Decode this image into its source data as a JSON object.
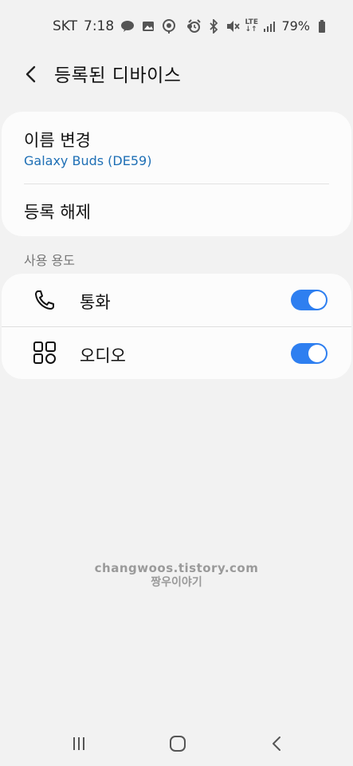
{
  "status_bar": {
    "carrier": "SKT",
    "time": "7:18",
    "battery": "79%",
    "left_icons": [
      "talk-icon",
      "gallery-icon",
      "location-icon",
      "dot-icon"
    ],
    "right_icons": [
      "alarm-icon",
      "bluetooth-icon",
      "mute-icon",
      "lte-icon",
      "signal-icon",
      "battery-icon"
    ],
    "lte_label": "LTE"
  },
  "header": {
    "title": "등록된 디바이스",
    "back_icon": "back-arrow-icon"
  },
  "device_card": {
    "rename_title": "이름 변경",
    "device_name": "Galaxy Buds (DE59)",
    "unregister_label": "등록 해제"
  },
  "usage": {
    "section_label": "사용 용도",
    "items": [
      {
        "label": "통화",
        "icon": "phone-icon",
        "enabled": true
      },
      {
        "label": "오디오",
        "icon": "audio-icon",
        "enabled": true
      }
    ]
  },
  "watermark": {
    "line1": "changwoos.tistory.com",
    "line2": "짱우이야기"
  },
  "navbar": {
    "recents": "recents-icon",
    "home": "home-icon",
    "back": "nav-back-icon"
  },
  "colors": {
    "accent": "#2e7ff0",
    "sub_text": "#1e6fb5",
    "background": "#f2f2f2",
    "card": "#fcfcfc"
  }
}
